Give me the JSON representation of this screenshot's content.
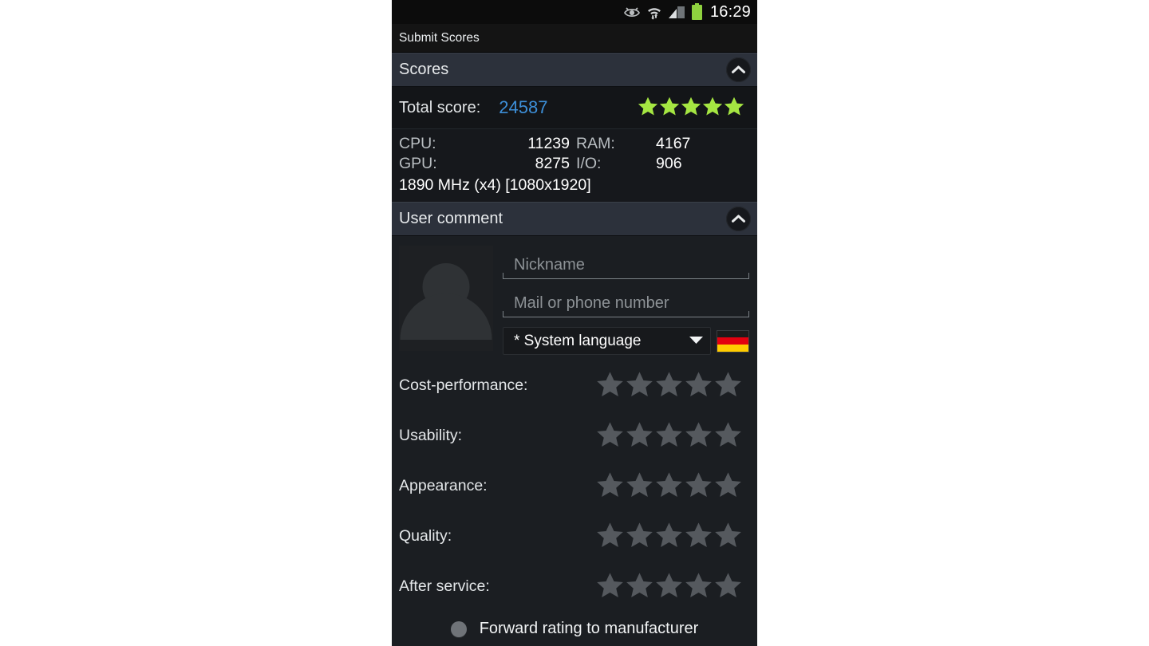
{
  "statusbar": {
    "icons": [
      "eye-care-icon",
      "wifi-icon",
      "cellular-signal-icon",
      "battery-icon"
    ],
    "time": "16:29",
    "battery_color": "#8fd23f"
  },
  "actionbar": {
    "title": "Submit Scores"
  },
  "sections": {
    "scores": {
      "title": "Scores",
      "collapse_icon": "chevron-up-icon",
      "total_label": "Total score:",
      "total_value": "24587",
      "total_value_color": "#3d8fd8",
      "total_stars_filled": 5,
      "total_stars_total": 5,
      "star_color": "#a5e642",
      "metrics": [
        {
          "label": "CPU:",
          "value": "11239"
        },
        {
          "label": "RAM:",
          "value": "4167"
        },
        {
          "label": "GPU:",
          "value": "8275"
        },
        {
          "label": "I/O:",
          "value": "906"
        }
      ],
      "hardware_line": "1890 MHz (x4) [1080x1920]"
    },
    "user_comment": {
      "title": "User comment",
      "collapse_icon": "chevron-up-icon",
      "avatar_icon": "person-placeholder-icon",
      "nickname_value": "",
      "nickname_placeholder": "Nickname",
      "contact_value": "",
      "contact_placeholder": "Mail or phone number",
      "language_selected": "* System language",
      "language_options": [
        "* System language"
      ],
      "dropdown_icon": "chevron-down-icon",
      "flag_icon": "german-flag-icon",
      "flag_colors": [
        "#1c1c1c",
        "#e3000f",
        "#ffcc00"
      ],
      "ratings": [
        {
          "label": "Cost-performance:",
          "stars_filled": 0,
          "stars_total": 5
        },
        {
          "label": "Usability:",
          "stars_filled": 0,
          "stars_total": 5
        },
        {
          "label": "Appearance:",
          "stars_filled": 0,
          "stars_total": 5
        },
        {
          "label": "Quality:",
          "stars_filled": 0,
          "stars_total": 5
        },
        {
          "label": "After service:",
          "stars_filled": 0,
          "stars_total": 5
        }
      ],
      "empty_star_color": "#55595e",
      "forward_label": "Forward rating to manufacturer",
      "forward_checked": false
    }
  }
}
